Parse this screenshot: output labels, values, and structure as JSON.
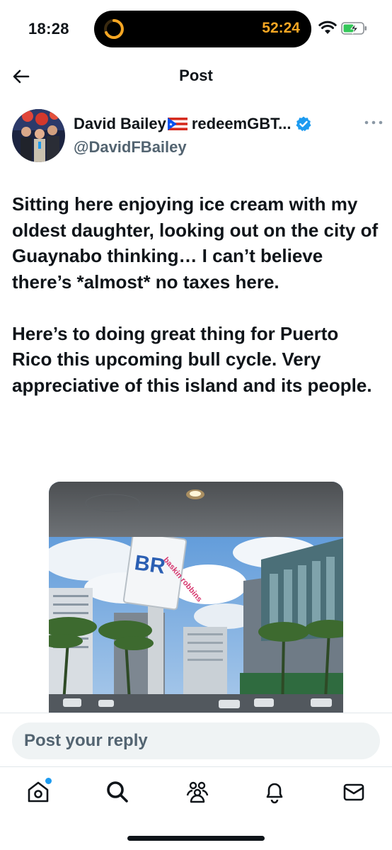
{
  "status_bar": {
    "time": "18:28",
    "live_activity_timer": "52:24",
    "accent_color": "#f5a623",
    "icons": [
      "wifi-icon",
      "battery-charging-icon"
    ]
  },
  "header": {
    "title": "Post",
    "back_icon": "back-arrow-icon"
  },
  "post": {
    "display_name": "David Bailey",
    "name_suffix": "redeemGBT...",
    "handle": "@DavidFBailey",
    "verified_color": "#1d9bf0",
    "paragraphs": [
      "Sitting here enjoying ice cream with my oldest daughter, looking out on the city of Guaynabo thinking… I can’t believe there’s *almost* no taxes here.",
      "Here’s to doing great thing for Puerto Rico this upcoming bull cycle. Very appreciative of this island and its people."
    ],
    "media": {
      "sign_logo": "BR",
      "sign_brand": "baskin robbins"
    }
  },
  "reply": {
    "placeholder": "Post your reply"
  },
  "nav": {
    "items": [
      "home-icon",
      "search-icon",
      "communities-icon",
      "notifications-icon",
      "messages-icon"
    ],
    "notification_dot_color": "#1d9bf0"
  }
}
